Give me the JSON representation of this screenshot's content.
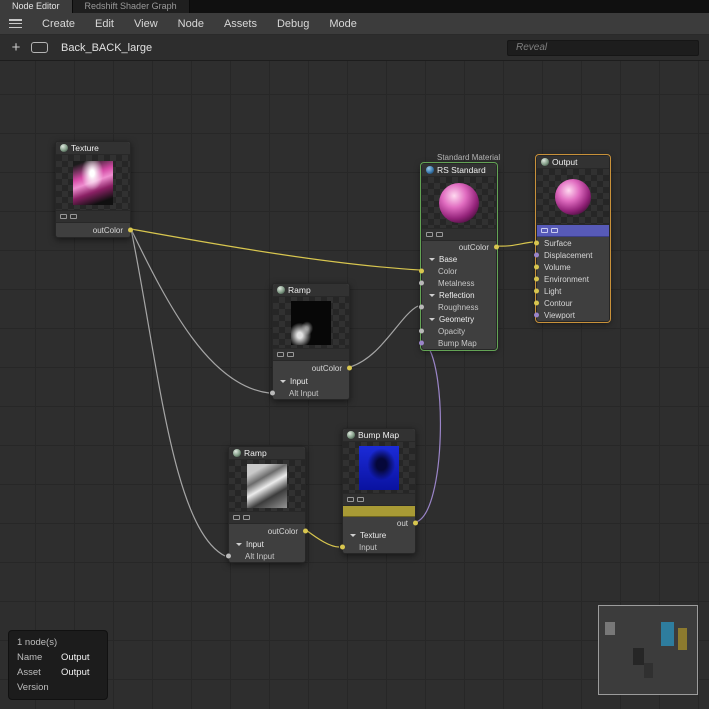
{
  "tabs": [
    "Node Editor",
    "Redshift Shader Graph"
  ],
  "menu": [
    "Create",
    "Edit",
    "View",
    "Node",
    "Assets",
    "Debug",
    "Mode"
  ],
  "toolbar": {
    "breadcrumb": "Back_BACK_large",
    "search_placeholder": "Reveal"
  },
  "nodes": {
    "texture": {
      "title": "Texture",
      "out_label": "outColor"
    },
    "ramp1": {
      "title": "Ramp",
      "out_label": "outColor",
      "section": "Input",
      "row": "Alt Input"
    },
    "ramp2": {
      "title": "Ramp",
      "out_label": "outColor",
      "section": "Input",
      "row": "Alt Input"
    },
    "bump": {
      "title": "Bump Map",
      "out_label": "out",
      "section": "Texture",
      "row": "Input"
    },
    "rs_standard": {
      "over_label": "Standard Material",
      "title": "RS Standard",
      "out_label": "outColor",
      "rows": [
        {
          "label": "Base"
        },
        {
          "label": "Color"
        },
        {
          "label": "Metalness"
        },
        {
          "label": "Reflection"
        },
        {
          "label": "Roughness"
        },
        {
          "label": "Geometry"
        },
        {
          "label": "Opacity"
        },
        {
          "label": "Bump Map"
        }
      ]
    },
    "output": {
      "title": "Output",
      "rows": [
        {
          "label": "Surface"
        },
        {
          "label": "Displacement"
        },
        {
          "label": "Volume"
        },
        {
          "label": "Environment"
        },
        {
          "label": "Light"
        },
        {
          "label": "Contour"
        },
        {
          "label": "Viewport"
        }
      ]
    }
  },
  "info_panel": {
    "count": "1 node(s)",
    "rows": [
      {
        "label": "Name",
        "value": "Output"
      },
      {
        "label": "Asset",
        "value": "Output"
      },
      {
        "label": "Version",
        "value": ""
      }
    ]
  },
  "colors": {
    "wire_yellow": "#d8c64f",
    "wire_gray": "#a6a6a6",
    "wire_purple": "#9b85c9",
    "selection_green": "#63a355",
    "selection_orange": "#c8913a",
    "surface_strip_blue": "#575ab8",
    "out_bar_olive": "#a89a35",
    "port_yellow": "#d8c64f",
    "port_gray": "#b9b9b9",
    "port_purple": "#9b85c9"
  }
}
